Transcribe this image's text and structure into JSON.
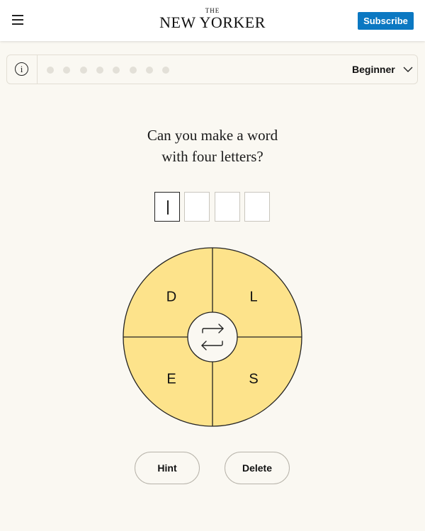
{
  "header": {
    "brand_the": "THE",
    "brand_name": "NEW YORKER",
    "subscribe_label": "Subscribe"
  },
  "toolbar": {
    "info_glyph": "i",
    "progress": {
      "total": 8,
      "completed": 0
    },
    "level": "Beginner"
  },
  "puzzle": {
    "prompt_line1": "Can you make a word",
    "prompt_line2": "with four letters?",
    "slot_count": 4,
    "entered": [
      "",
      "",
      "",
      ""
    ],
    "active_slot": 0,
    "letters": [
      "D",
      "L",
      "E",
      "S"
    ],
    "wheel_color": "#fde38b",
    "shuffle_icon": "shuffle-arrows-icon"
  },
  "actions": {
    "hint_label": "Hint",
    "delete_label": "Delete"
  }
}
